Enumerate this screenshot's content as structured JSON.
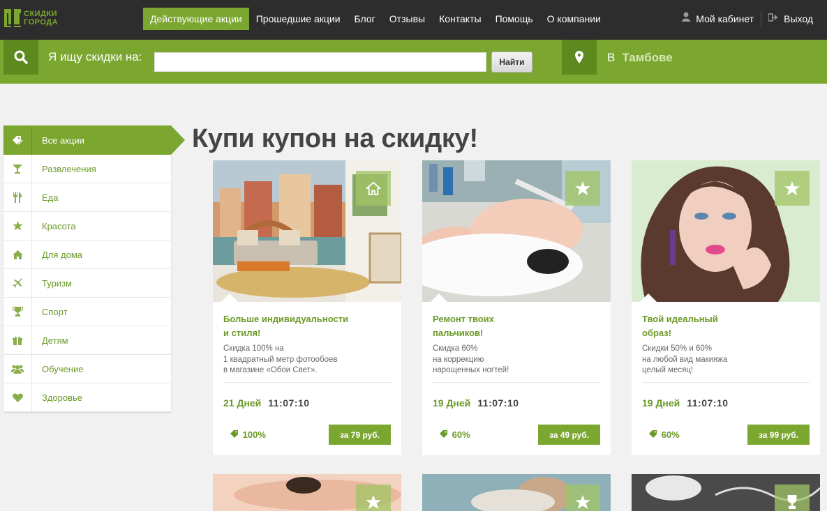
{
  "logo": {
    "line1": "СКИДКИ",
    "line2": "ГОРОДА"
  },
  "nav": {
    "items": [
      "Действующие акции",
      "Прошедшие акции",
      "Блог",
      "Отзывы",
      "Контакты",
      "Помощь",
      "О компании"
    ]
  },
  "user": {
    "cabinet": "Мой кабинет",
    "logout": "Выход"
  },
  "search": {
    "label": "Я ищу скидки на:",
    "value": "",
    "button": "Найти"
  },
  "city": {
    "prefix": "В",
    "name": "Тамбове"
  },
  "sidebar": {
    "items": [
      {
        "label": "Все акции",
        "icon": "tag-icon"
      },
      {
        "label": "Развлечения",
        "icon": "cocktail-icon"
      },
      {
        "label": "Еда",
        "icon": "cutlery-icon"
      },
      {
        "label": "Красота",
        "icon": "star-icon"
      },
      {
        "label": "Для дома",
        "icon": "home-icon"
      },
      {
        "label": "Туризм",
        "icon": "plane-icon"
      },
      {
        "label": "Спорт",
        "icon": "trophy-icon"
      },
      {
        "label": "Детям",
        "icon": "gift-icon"
      },
      {
        "label": "Обучение",
        "icon": "users-icon"
      },
      {
        "label": "Здоровье",
        "icon": "heart-icon"
      }
    ]
  },
  "page_title": "Купи купон на скидку!",
  "cards": [
    {
      "title_l1": "Больше индивидуальности",
      "title_l2": "и стиля!",
      "desc_l1": "Скидка 100% на",
      "desc_l2": "1 квадратный метр фотообоев",
      "desc_l3": "в магазине «Обои Свет».",
      "days": "21 Дней",
      "time": "11:07:10",
      "discount": "100%",
      "price": "за 79 руб."
    },
    {
      "title_l1": "Ремонт твоих",
      "title_l2": "пальчиков!",
      "desc_l1": "Скидка 60%",
      "desc_l2": "на коррекцию",
      "desc_l3": "нарощенных ногтей!",
      "days": "19 Дней",
      "time": "11:07:10",
      "discount": "60%",
      "price": "за 49 руб."
    },
    {
      "title_l1": "Твой идеальный",
      "title_l2": "образ!",
      "desc_l1": "Скидки 50% и 60%",
      "desc_l2": "на любой вид макияжа",
      "desc_l3": "целый месяц!",
      "days": "19 Дней",
      "time": "11:07:10",
      "discount": "60%",
      "price": "за 99 руб."
    }
  ]
}
